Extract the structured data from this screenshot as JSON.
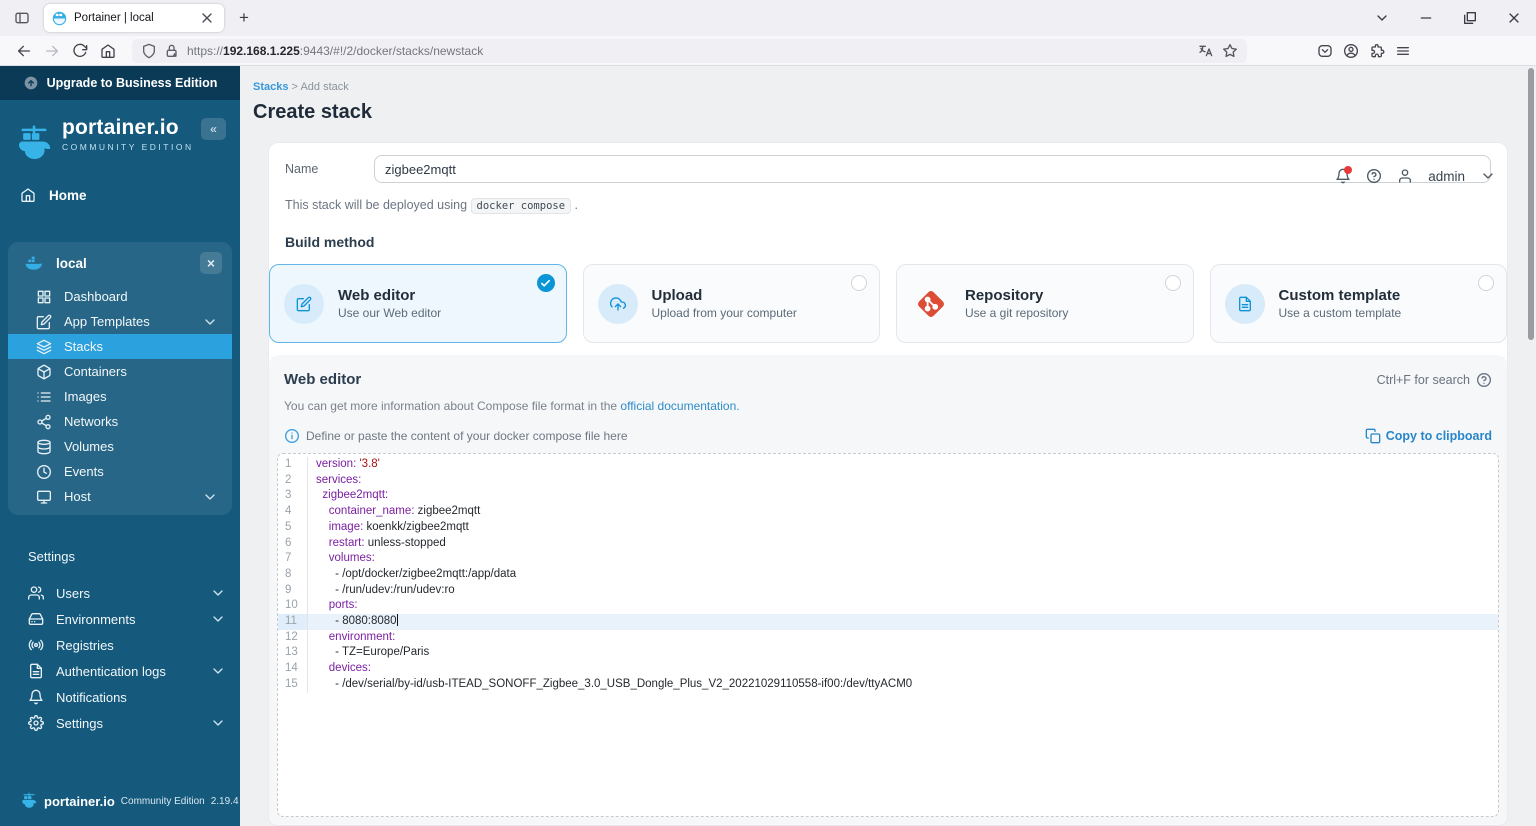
{
  "browser": {
    "tab_title": "Portainer | local",
    "url": {
      "scheme": "https://",
      "host": "192.168.1.225",
      "rest": ":9443/#!/2/docker/stacks/newstack"
    },
    "new_tab_glyph": "+"
  },
  "icons_unicode": {
    "collapse": "«",
    "tab_close": "×",
    "env_close": "×"
  },
  "sidebar": {
    "upgrade_banner": "Upgrade to Business Edition",
    "logo_title": "portainer.io",
    "logo_subtitle": "COMMUNITY EDITION",
    "home_label": "Home",
    "environment": {
      "name": "local",
      "items": [
        {
          "label": "Dashboard",
          "icon": "grid"
        },
        {
          "label": "App Templates",
          "icon": "edit",
          "chevron": true
        },
        {
          "label": "Stacks",
          "icon": "layers",
          "active": true
        },
        {
          "label": "Containers",
          "icon": "box"
        },
        {
          "label": "Images",
          "icon": "list"
        },
        {
          "label": "Networks",
          "icon": "share"
        },
        {
          "label": "Volumes",
          "icon": "db"
        },
        {
          "label": "Events",
          "icon": "clock"
        },
        {
          "label": "Host",
          "icon": "monitor",
          "chevron": true
        }
      ]
    },
    "settings_header": "Settings",
    "settings_items": [
      {
        "label": "Users",
        "icon": "users",
        "chevron": true
      },
      {
        "label": "Environments",
        "icon": "drive",
        "chevron": true
      },
      {
        "label": "Registries",
        "icon": "radio"
      },
      {
        "label": "Authentication logs",
        "icon": "filetext",
        "chevron": true
      },
      {
        "label": "Notifications",
        "icon": "bell"
      },
      {
        "label": "Settings",
        "icon": "gear",
        "chevron": true
      }
    ],
    "footer": {
      "brand": "portainer.io",
      "edition": "Community Edition",
      "version": "2.19.4"
    }
  },
  "header": {
    "breadcrumb": {
      "link": "Stacks",
      "separator": ">",
      "current": "Add stack"
    },
    "title": "Create stack",
    "user": "admin"
  },
  "form": {
    "name_label": "Name",
    "name_value": "zigbee2mqtt",
    "deploy_note_prefix": "This stack will be deployed using",
    "deploy_note_code": "docker compose",
    "deploy_note_suffix": ".",
    "build_method_label": "Build method",
    "methods": [
      {
        "title": "Web editor",
        "subtitle": "Use our Web editor",
        "icon": "edit",
        "circle": true,
        "selected": true
      },
      {
        "title": "Upload",
        "subtitle": "Upload from your computer",
        "icon": "cloudup",
        "circle": true,
        "selected": false
      },
      {
        "title": "Repository",
        "subtitle": "Use a git repository",
        "icon": "git",
        "circle": false,
        "selected": false
      },
      {
        "title": "Custom template",
        "subtitle": "Use a custom template",
        "icon": "filetext",
        "circle": true,
        "selected": false
      }
    ]
  },
  "editor": {
    "title": "Web editor",
    "search_hint": "Ctrl+F for search",
    "info_prefix": "You can get more information about Compose file format in the",
    "info_link": "official documentation.",
    "note": "Define or paste the content of your docker compose file here",
    "copy_label": "Copy to clipboard",
    "active_line": 11,
    "cursor_line": 11,
    "lines": [
      [
        [
          "key",
          "version:"
        ],
        [
          "pln",
          " "
        ],
        [
          "str",
          "'3.8'"
        ]
      ],
      [
        [
          "key",
          "services:"
        ]
      ],
      [
        [
          "pln",
          "  "
        ],
        [
          "key",
          "zigbee2mqtt:"
        ]
      ],
      [
        [
          "pln",
          "    "
        ],
        [
          "key",
          "container_name:"
        ],
        [
          "pln",
          " zigbee2mqtt"
        ]
      ],
      [
        [
          "pln",
          "    "
        ],
        [
          "key",
          "image:"
        ],
        [
          "pln",
          " koenkk/zigbee2mqtt"
        ]
      ],
      [
        [
          "pln",
          "    "
        ],
        [
          "key",
          "restart:"
        ],
        [
          "pln",
          " unless-stopped"
        ]
      ],
      [
        [
          "pln",
          "    "
        ],
        [
          "key",
          "volumes:"
        ]
      ],
      [
        [
          "pln",
          "      - /opt/docker/zigbee2mqtt:/app/data"
        ]
      ],
      [
        [
          "pln",
          "      - /run/udev:/run/udev:ro"
        ]
      ],
      [
        [
          "pln",
          "    "
        ],
        [
          "key",
          "ports:"
        ]
      ],
      [
        [
          "pln",
          "      - 8080:8080"
        ]
      ],
      [
        [
          "pln",
          "    "
        ],
        [
          "key",
          "environment:"
        ]
      ],
      [
        [
          "pln",
          "      - TZ=Europe/Paris"
        ]
      ],
      [
        [
          "pln",
          "    "
        ],
        [
          "key",
          "devices:"
        ]
      ],
      [
        [
          "pln",
          "      - /dev/serial/by-id/usb-ITEAD_SONOFF_Zigbee_3.0_USB_Dongle_Plus_V2_20221029110558-if00:/dev/ttyACM0"
        ]
      ]
    ]
  }
}
